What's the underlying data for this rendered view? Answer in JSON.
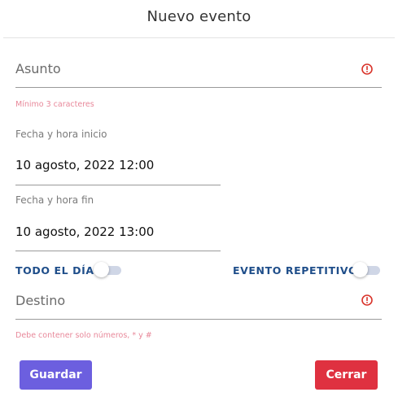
{
  "dialog": {
    "title": "Nuevo evento"
  },
  "subject": {
    "placeholder": "Asunto",
    "hint": "Mínimo 3 caracteres",
    "icon": "error-circle-icon"
  },
  "start": {
    "label": "Fecha y hora inicio",
    "value": "10 agosto, 2022 12:00"
  },
  "end": {
    "label": "Fecha y hora fin",
    "value": "10 agosto, 2022 13:00"
  },
  "toggles": {
    "all_day_label": "TODO EL DÍA",
    "all_day_on": false,
    "repeat_label": "EVENTO REPETITIVO",
    "repeat_on": false
  },
  "destination": {
    "placeholder": "Destino",
    "hint": "Debe contener solo números, * y #",
    "icon": "error-circle-icon"
  },
  "buttons": {
    "save_label": "Guardar",
    "close_label": "Cerrar"
  },
  "colors": {
    "save": "#6c5fdf",
    "close": "#df3140",
    "error": "#d9342b",
    "hint": "#e8889a",
    "toggle_label": "#1f4e8a"
  }
}
